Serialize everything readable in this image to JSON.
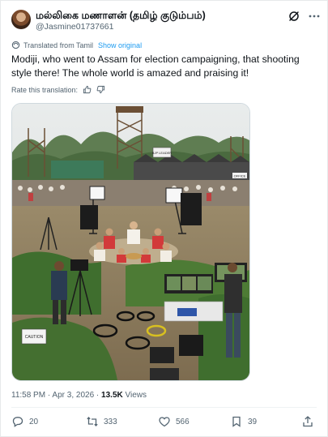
{
  "author": {
    "display_name": "மல்லிகை மணாளன் (தமிழ் குடும்பம்)",
    "handle": "@Jasmine01737661"
  },
  "header_icons": [
    "grok-icon",
    "more-options-icon"
  ],
  "translation": {
    "label": "Translated from Tamil",
    "show_original": "Show original",
    "rate_label": "Rate this translation:"
  },
  "tweet": {
    "text": "Modiji, who went to Assam for election campaigning, that shooting style there! The whole world is amazed and praising it!"
  },
  "image_signs": {
    "tent_sign": "BJP LEADER",
    "office_sign": "OFFICE",
    "caution_sign": "CAUTION"
  },
  "meta": {
    "time": "11:58 PM",
    "date": "Apr 3, 2026",
    "dot": "·",
    "views_count": "13.5K",
    "views_label": "Views"
  },
  "actions": {
    "replies": "20",
    "reposts": "333",
    "likes": "566",
    "bookmarks": "39"
  },
  "colors": {
    "text": "#0f1419",
    "secondary": "#536471",
    "link": "#1d9bf0",
    "border": "#cfd9de"
  }
}
